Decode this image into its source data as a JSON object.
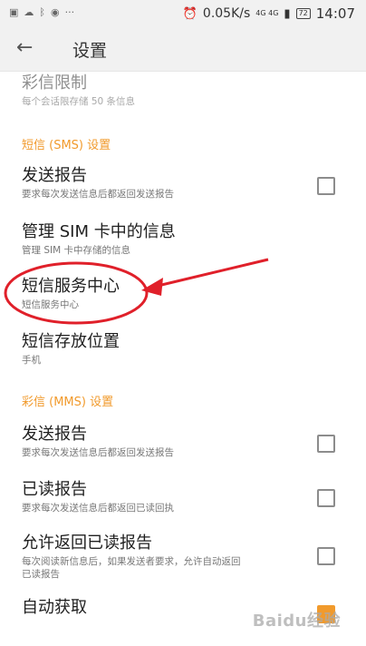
{
  "status_bar": {
    "icons": [
      "image-icon",
      "cloud-icon",
      "bluetooth-icon",
      "record-icon",
      "more-icon"
    ],
    "dots": "···",
    "net_speed": "0.05K/s",
    "network_label": "4G 4G",
    "battery": "72",
    "time": "14:07"
  },
  "appbar": {
    "back_glyph": "←",
    "title": "设置"
  },
  "items": {
    "mms_limit": {
      "title": "彩信限制",
      "subtitle": "每个会话限存储 50 条信息"
    },
    "sms_section": "短信 (SMS) 设置",
    "sms_delivery": {
      "title": "发送报告",
      "subtitle": "要求每次发送信息后都返回发送报告",
      "checked": false
    },
    "sim_messages": {
      "title": "管理 SIM 卡中的信息",
      "subtitle": "管理 SIM 卡中存储的信息"
    },
    "smsc": {
      "title": "短信服务中心",
      "subtitle": "短信服务中心"
    },
    "storage": {
      "title": "短信存放位置",
      "subtitle": "手机"
    },
    "mms_section": "彩信 (MMS) 设置",
    "mms_delivery": {
      "title": "发送报告",
      "subtitle": "要求每次发送信息后都返回发送报告",
      "checked": false
    },
    "read_report": {
      "title": "已读报告",
      "subtitle": "要求每次发送信息后都返回已读回执",
      "checked": false
    },
    "allow_read": {
      "title": "允许返回已读报告",
      "subtitle_1": "每次阅读新信息后，如果发送者要求，允许自动返回",
      "subtitle_2": "已读报告",
      "checked": false
    },
    "auto_retrieve": {
      "title": "自动获取",
      "checked": true
    }
  },
  "annotation": {
    "color": "#e0202a"
  },
  "watermark": "Baidu经验",
  "colors": {
    "accent": "#f19a2c",
    "appbar_bg": "#f1f1f1"
  }
}
